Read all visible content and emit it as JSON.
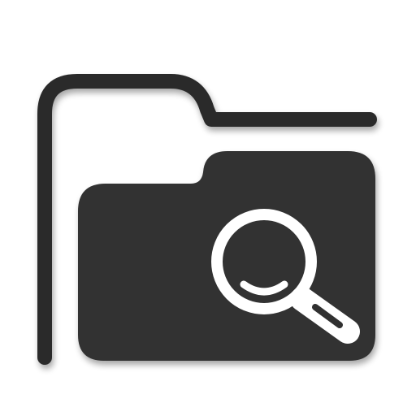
{
  "icon": {
    "name": "folder-search-icon",
    "colors": {
      "background": "#ffffff",
      "folder_fill": "#303030",
      "outline_stroke": "#2a2a2a",
      "magnifier": "#ffffff",
      "shadow": "#000000"
    }
  }
}
